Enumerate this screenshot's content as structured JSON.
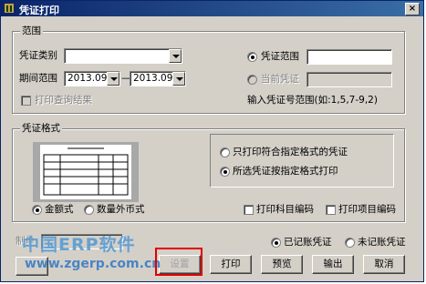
{
  "window": {
    "title": "凭证打印",
    "close_label": "×"
  },
  "range_group": {
    "label": "范围",
    "voucher_type_label": "凭证类别",
    "voucher_type_value": "",
    "period_label": "期间范围",
    "period_from": "2013.09",
    "period_sep": "—",
    "period_to": "2013.09",
    "print_query_result_label": "打印查询结果",
    "voucher_range_label": "凭证范围",
    "voucher_range_value": "",
    "current_voucher_label": "当前凭证",
    "current_voucher_value": "",
    "hint": "输入凭证号范围(如:1,5,7-9,2)"
  },
  "format_group": {
    "label": "凭证格式",
    "only_print_label": "只打印符合指定格式的凭证",
    "all_print_label": "所选凭证按指定格式打印",
    "amount_label": "金额式",
    "foreign_label": "数量外币式",
    "print_subject_code_label": "打印科目编码",
    "print_project_code_label": "打印项目编码"
  },
  "bottom": {
    "maker_label": "制单",
    "posted_label": "已记账凭证",
    "unposted_label": "未记账凭证"
  },
  "buttons": {
    "settings": "设置",
    "print": "打印",
    "preview": "预览",
    "export": "输出",
    "cancel": "取消"
  },
  "watermark": {
    "name": "中国ERP软件",
    "url": "www.zgerp.com.cn"
  },
  "colors": {
    "titlebar": "#0a246a",
    "highlight_box": "#e00000",
    "watermark": "#5a9bd5"
  }
}
